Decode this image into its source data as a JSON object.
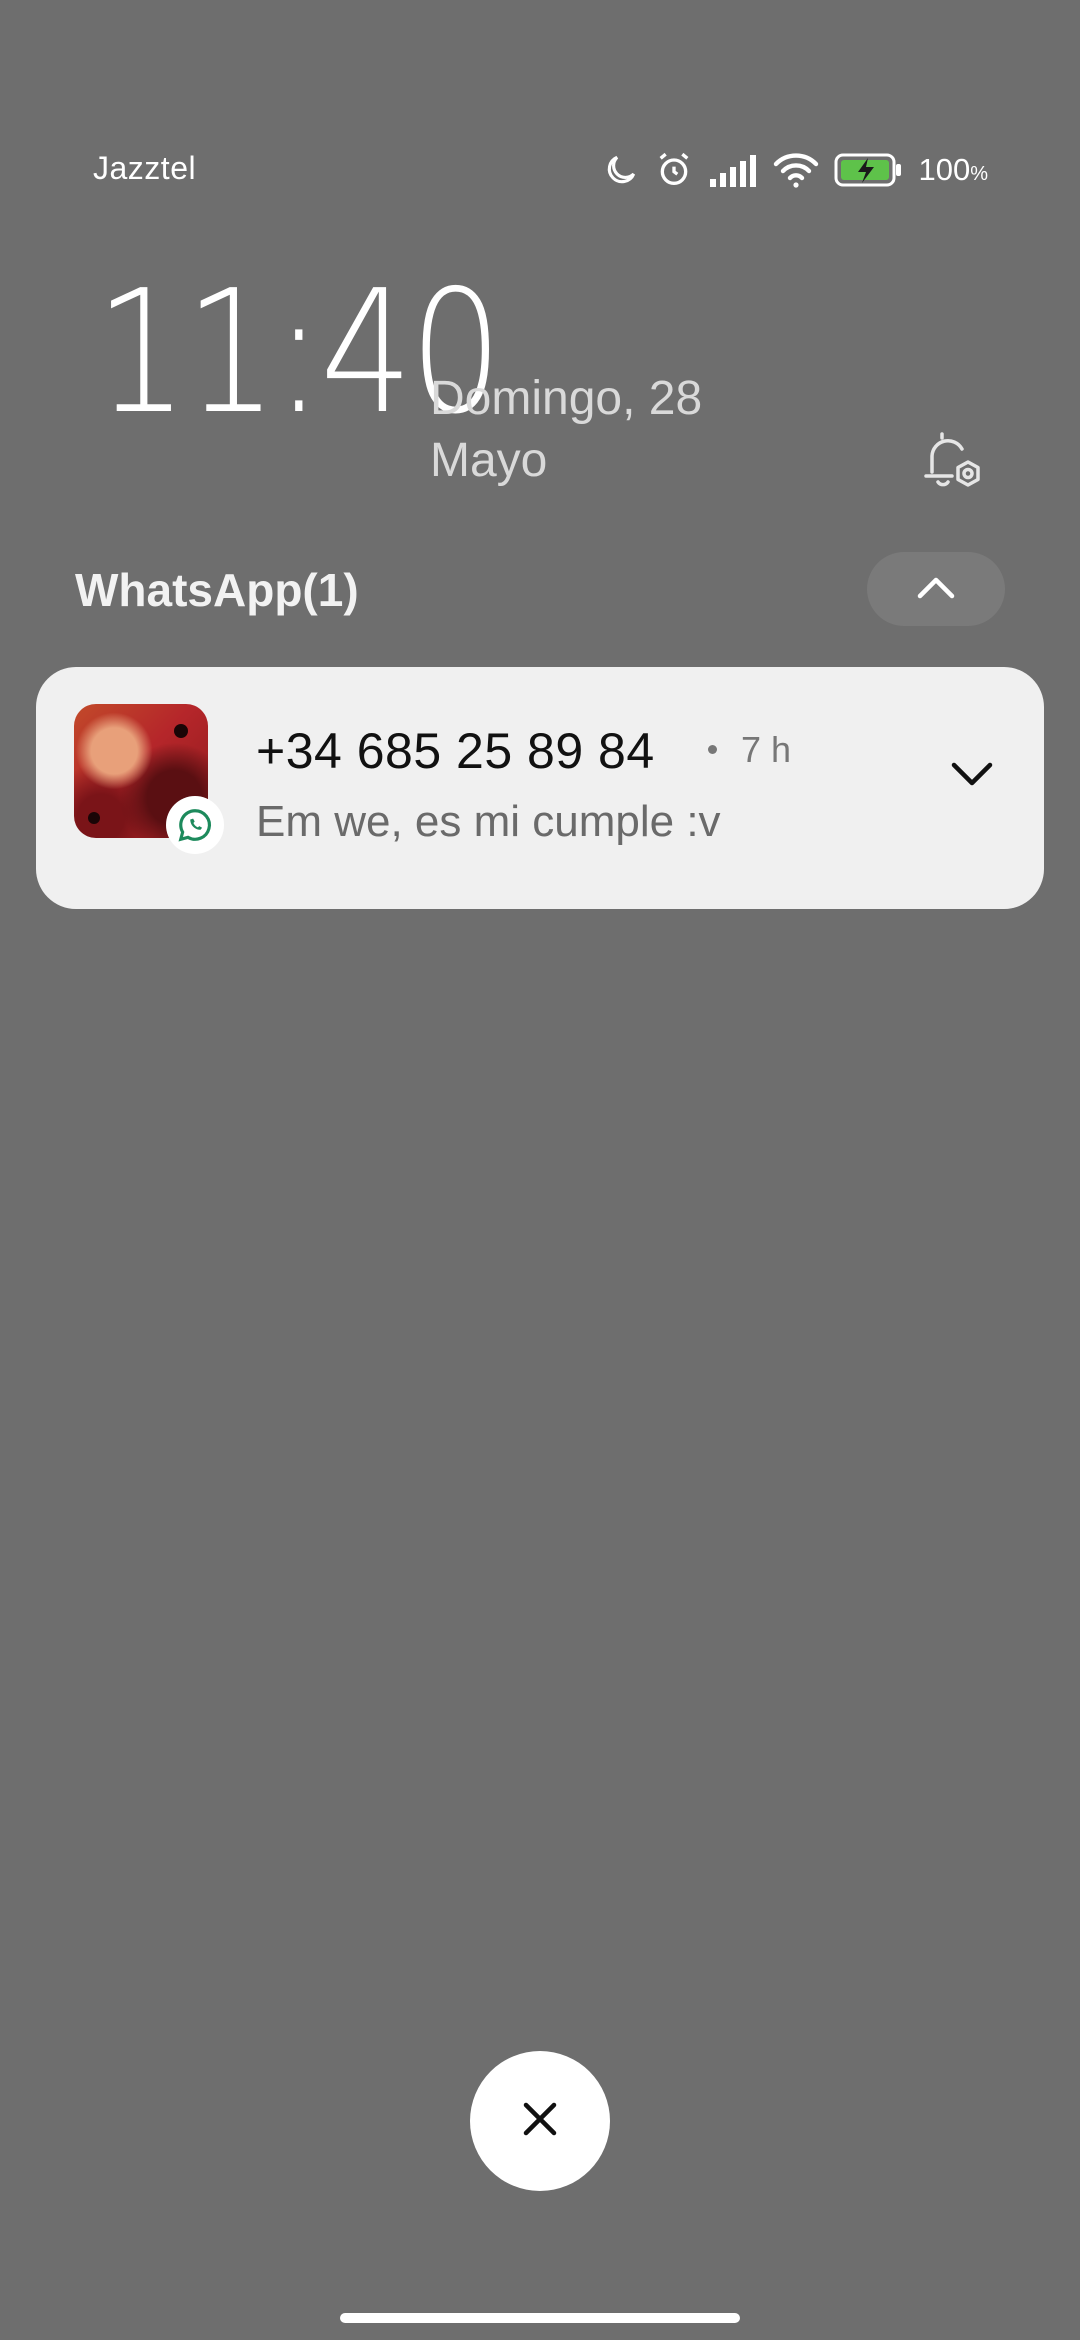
{
  "status_bar": {
    "carrier": "Jazztel",
    "battery_percent": "100",
    "battery_unit": "%",
    "icons": [
      "moon-icon",
      "alarm-icon",
      "signal-icon",
      "wifi-icon",
      "battery-charging-icon"
    ]
  },
  "lockscreen": {
    "time": "11:40",
    "date_line1": "Domingo, 28",
    "date_line2": "Mayo"
  },
  "notification_group": {
    "title": "WhatsApp(1)",
    "collapse_icon": "chevron-up-icon"
  },
  "notification": {
    "sender": "+34 685 25 89 84",
    "time_ago": "7 h",
    "message": "Em we, es mi cumple :v",
    "app_badge_icon": "whatsapp-icon",
    "expand_icon": "chevron-down-icon",
    "accent_color": "#1d8a5c"
  },
  "actions": {
    "close_icon": "close-icon"
  },
  "colors": {
    "background": "#6e6e6e",
    "card": "#f0f0f0"
  }
}
